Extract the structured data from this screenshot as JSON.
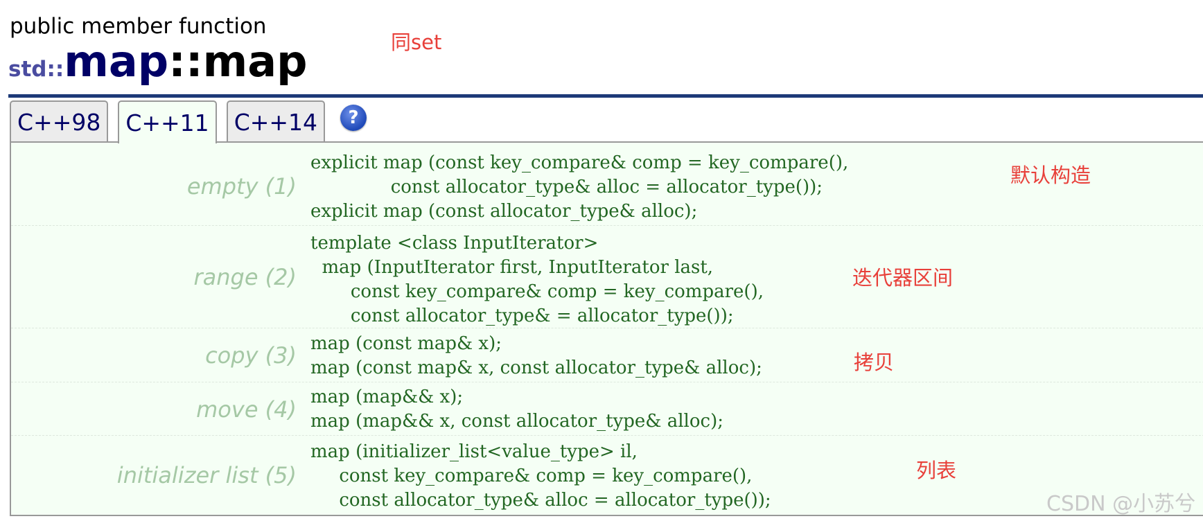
{
  "header": {
    "kind": "public member function",
    "title_namespace": "std::",
    "title_class": "map",
    "title_member": "::map"
  },
  "tabs": [
    {
      "label": "C++98",
      "active": false
    },
    {
      "label": "C++11",
      "active": true
    },
    {
      "label": "C++14",
      "active": false
    }
  ],
  "help_icon": {
    "glyph": "?",
    "icon": "help-icon",
    "color": "#1f49b8"
  },
  "annotations": {
    "same_set": "同set",
    "default_ctor": "默认构造",
    "range": "迭代器区间",
    "copy": "拷贝",
    "list": "列表"
  },
  "constructors": [
    {
      "label": "empty (1)",
      "code": "explicit map (const key_compare& comp = key_compare(),\n              const allocator_type& alloc = allocator_type());\nexplicit map (const allocator_type& alloc);"
    },
    {
      "label": "range (2)",
      "code": "template <class InputIterator>\n  map (InputIterator first, InputIterator last,\n       const key_compare& comp = key_compare(),\n       const allocator_type& = allocator_type());"
    },
    {
      "label": "copy (3)",
      "code": "map (const map& x);\nmap (const map& x, const allocator_type& alloc);"
    },
    {
      "label": "move (4)",
      "code": "map (map&& x);\nmap (map&& x, const allocator_type& alloc);"
    },
    {
      "label": "initializer list (5)",
      "code": "map (initializer_list<value_type> il,\n     const key_compare& comp = key_compare(),\n     const allocator_type& alloc = allocator_type());"
    }
  ],
  "watermark": "CSDN @小苏兮",
  "colors": {
    "rule": "#1d3a78",
    "panel_bg": "#f5fff5",
    "code": "#226622",
    "label": "#a5c8a5",
    "annotation": "#e8403a"
  }
}
